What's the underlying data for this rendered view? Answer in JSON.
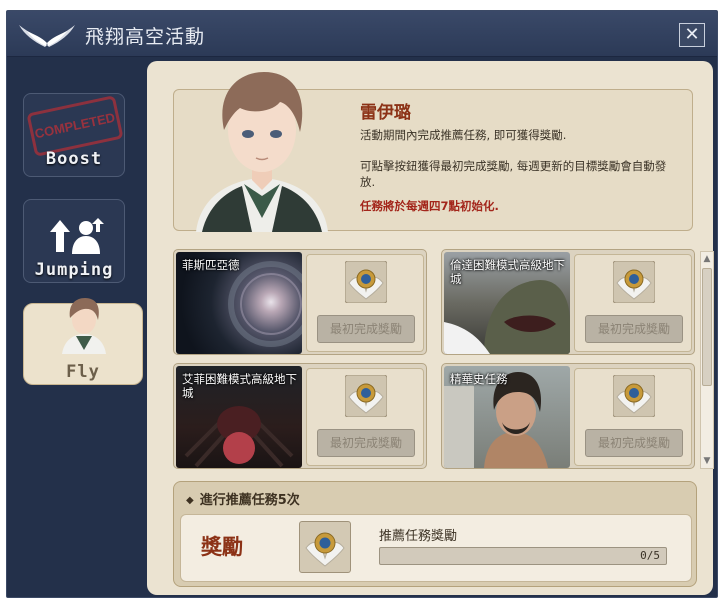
{
  "window": {
    "title": "飛翔高空活動",
    "close_label": "✕"
  },
  "sidebar": {
    "tabs": [
      {
        "label": "Boost",
        "stamp": "COMPLETED"
      },
      {
        "label": "Jumping"
      },
      {
        "label": "Fly",
        "selected": true
      }
    ]
  },
  "hero": {
    "name": "雷伊璐",
    "desc1": "活動期間內完成推薦任務, 即可獲得獎勵.",
    "desc2": "可點擊按鈕獲得最初完成獎勵, 每週更新的目標獎勵會自動發放.",
    "notice": "任務將於每週四7點初始化."
  },
  "missions": [
    {
      "title": "菲斯匹亞德",
      "button": "最初完成獎勵"
    },
    {
      "title": "倫達困難模式高級地下城",
      "button": "最初完成獎勵"
    },
    {
      "title": "艾菲困難模式高級地下城",
      "button": "最初完成獎勵"
    },
    {
      "title": "精華史任務",
      "button": "最初完成獎勵"
    }
  ],
  "bottom": {
    "heading": "進行推薦任務5次",
    "reward_label": "獎勵",
    "progress_title": "推薦任務獎勵",
    "progress_text": "0/5",
    "progress_fraction": 0
  },
  "colors": {
    "accent": "#8c3216",
    "notice": "#a3261b",
    "window_bg": "#23304a",
    "panel_bg": "#ebe3d1"
  },
  "icons": [
    "wings-icon",
    "close-icon",
    "completed-stamp-icon",
    "jump-arrows-icon",
    "reward-emblem-icon"
  ]
}
